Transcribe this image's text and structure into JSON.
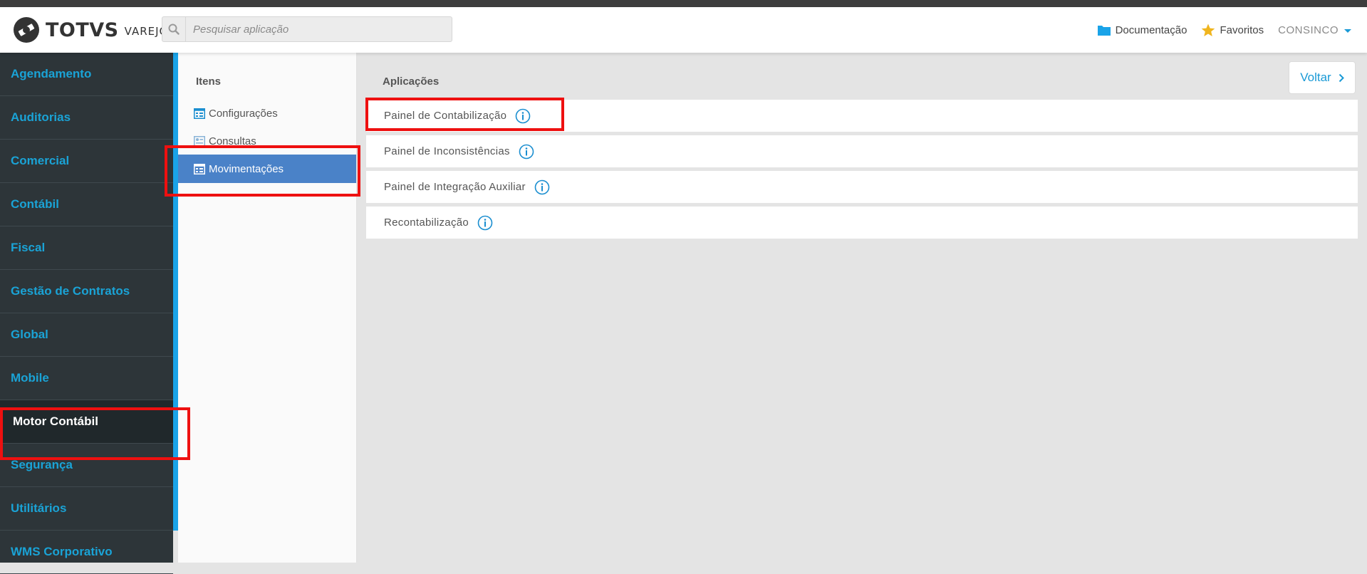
{
  "header": {
    "brand": "TOTVS",
    "brand_sub": "VAREJO",
    "search_placeholder": "Pesquisar aplicação",
    "documentation": "Documentação",
    "favorites": "Favoritos",
    "user": "CONSINCO"
  },
  "sidebar": {
    "items": [
      {
        "label": "Agendamento"
      },
      {
        "label": "Auditorias"
      },
      {
        "label": "Comercial"
      },
      {
        "label": "Contábil"
      },
      {
        "label": "Fiscal"
      },
      {
        "label": "Gestão de Contratos"
      },
      {
        "label": "Global"
      },
      {
        "label": "Mobile"
      },
      {
        "label": "Motor Contábil",
        "active": true
      },
      {
        "label": "Segurança"
      },
      {
        "label": "Utilitários"
      },
      {
        "label": "WMS Corporativo"
      }
    ]
  },
  "items_panel": {
    "title": "Itens",
    "items": [
      {
        "label": "Configurações"
      },
      {
        "label": "Consultas"
      },
      {
        "label": "Movimentações",
        "active": true
      }
    ]
  },
  "applications": {
    "title": "Aplicações",
    "back": "Voltar",
    "items": [
      {
        "label": "Painel de Contabilização"
      },
      {
        "label": "Painel de Inconsistências"
      },
      {
        "label": "Painel de Integração Auxiliar"
      },
      {
        "label": "Recontabilização"
      }
    ]
  },
  "colors": {
    "accent": "#1aa3d6",
    "sidebar_bg": "#2d3539",
    "active_sub": "#4a82c8",
    "highlight": "#ee1010",
    "star": "#f0b51e"
  }
}
